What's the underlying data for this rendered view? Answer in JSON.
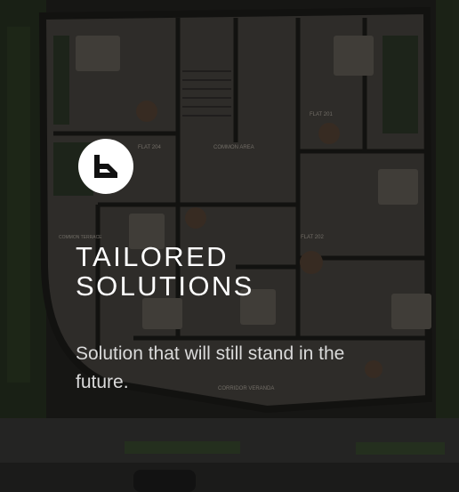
{
  "card": {
    "badge_icon": "logo-mark-icon",
    "title_lines": [
      "TAILORED",
      "SOLUTIONS"
    ],
    "description": "Solution that will still stand in the future."
  },
  "plan_labels": {
    "flat_204": "FLAT 204",
    "common_area": "COMMON AREA",
    "flat_201": "FLAT 201",
    "flat_202": "FLAT 202",
    "corridor": "CORRIDOR VERANDA",
    "common_terrace": "COMMON TERRACE"
  },
  "colors": {
    "overlay": "#080808",
    "badge": "#ffffff",
    "title": "#ffffff",
    "description": "#dadada"
  }
}
